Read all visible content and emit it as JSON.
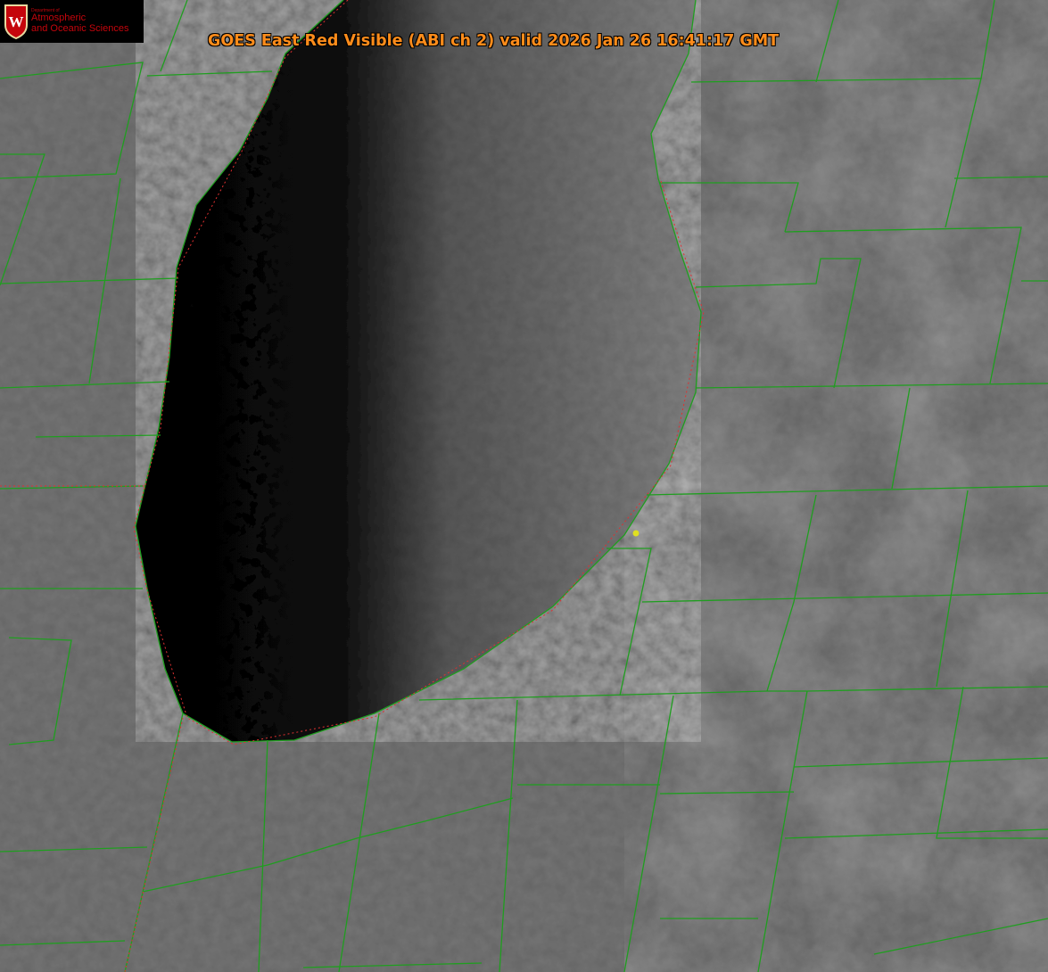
{
  "title": "GOES East Red Visible (ABI ch 2) valid 2026 Jan 26 16:41:17 GMT",
  "logo": {
    "department": "Department of",
    "line1": "Atmospheric",
    "line2": "and Oceanic Sciences",
    "crest_letter": "W"
  },
  "colors": {
    "title": "#ff8c1a",
    "county_lines": "#1f9e1f",
    "state_lines": "#e03030",
    "marker": "#e0e020",
    "logo_red": "#c5050c"
  },
  "marker_icon": "location-dot"
}
